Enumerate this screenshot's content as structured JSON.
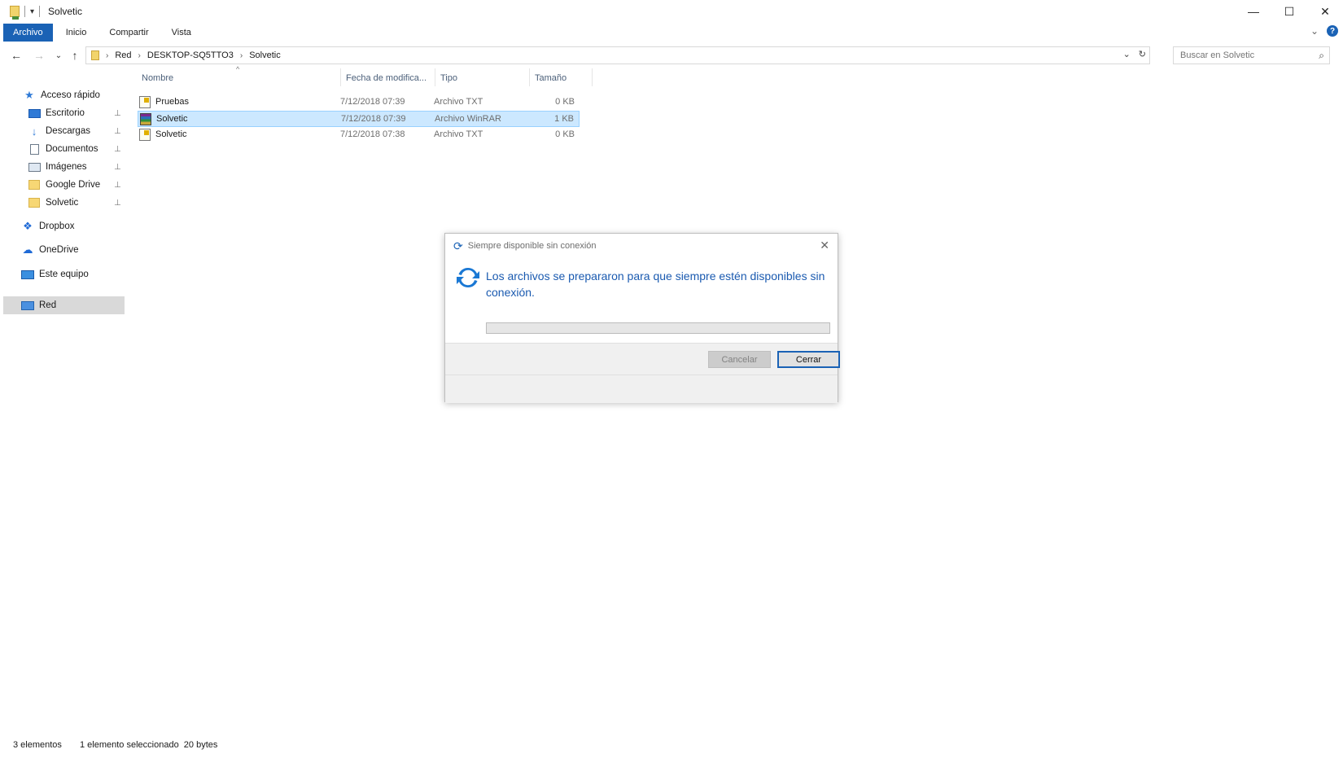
{
  "window": {
    "title": "Solvetic",
    "controls": {
      "minimize": "—",
      "maximize": "☐",
      "close": "✕"
    }
  },
  "ribbon": {
    "tabs": [
      {
        "label": "Archivo",
        "active": true
      },
      {
        "label": "Inicio",
        "active": false
      },
      {
        "label": "Compartir",
        "active": false
      },
      {
        "label": "Vista",
        "active": false
      }
    ],
    "expand": "⌄",
    "help": "?"
  },
  "nav": {
    "back": "←",
    "forward": "→",
    "recent": "⌄",
    "up": "↑",
    "breadcrumb": [
      "Red",
      "DESKTOP-SQ5TTO3",
      "Solvetic"
    ],
    "crumb_sep": "›",
    "history": "⌄",
    "refresh": "↻"
  },
  "search": {
    "placeholder": "Buscar en Solvetic",
    "icon": "⌕"
  },
  "sidebar": {
    "items": [
      {
        "label": "Acceso rápido",
        "icon": "star-icon"
      },
      {
        "label": "Escritorio",
        "icon": "desktop-icon",
        "pinned": true
      },
      {
        "label": "Descargas",
        "icon": "download-icon",
        "pinned": true
      },
      {
        "label": "Documentos",
        "icon": "document-icon",
        "pinned": true
      },
      {
        "label": "Imágenes",
        "icon": "pictures-icon",
        "pinned": true
      },
      {
        "label": "Google Drive",
        "icon": "folder-icon",
        "pinned": true
      },
      {
        "label": "Solvetic",
        "icon": "folder-icon",
        "pinned": true
      },
      {
        "label": "Dropbox",
        "icon": "dropbox-icon"
      },
      {
        "label": "OneDrive",
        "icon": "cloud-icon"
      },
      {
        "label": "Este equipo",
        "icon": "computer-icon"
      },
      {
        "label": "Red",
        "icon": "network-icon",
        "selected": true
      }
    ],
    "pin_glyph": "📌"
  },
  "columns": {
    "name": "Nombre",
    "date": "Fecha de modifica...",
    "type": "Tipo",
    "size": "Tamaño"
  },
  "files": [
    {
      "name": "Pruebas",
      "date": "7/12/2018 07:39",
      "type": "Archivo TXT",
      "size": "0 KB",
      "icon": "text-file-icon",
      "selected": false
    },
    {
      "name": "Solvetic",
      "date": "7/12/2018 07:39",
      "type": "Archivo WinRAR",
      "size": "1 KB",
      "icon": "winrar-file-icon",
      "selected": true
    },
    {
      "name": "Solvetic",
      "date": "7/12/2018 07:38",
      "type": "Archivo TXT",
      "size": "0 KB",
      "icon": "text-file-icon",
      "selected": false
    }
  ],
  "dialog": {
    "title": "Siempre disponible sin conexión",
    "message": "Los archivos se prepararon para que siempre estén disponibles sin conexión.",
    "progress": 0,
    "cancel_label": "Cancelar",
    "close_label": "Cerrar",
    "close_glyph": "✕",
    "sync_glyph": "⟳"
  },
  "status": {
    "count": "3 elementos",
    "selection": "1 elemento seleccionado  20 bytes"
  },
  "colors": {
    "accent": "#1a62b5",
    "selection": "#cce8ff",
    "selection_border": "#99d1ff",
    "dialog_text": "#1a5ab0"
  }
}
